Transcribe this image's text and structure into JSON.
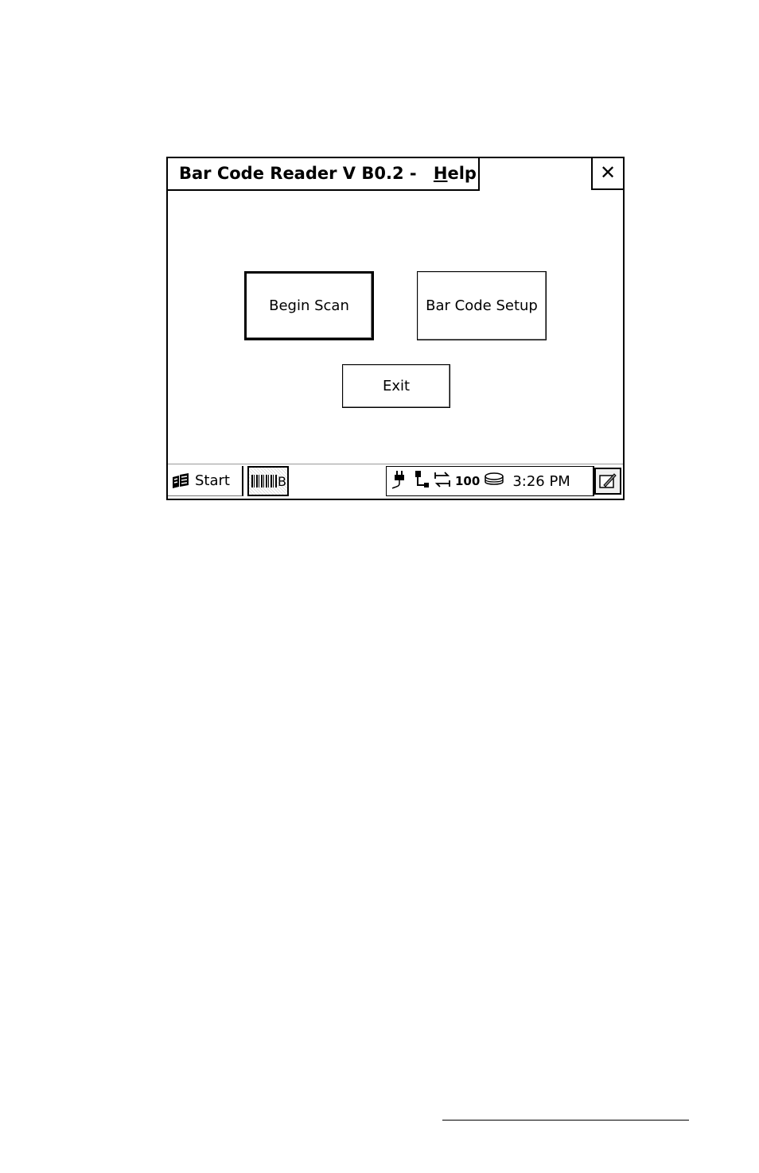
{
  "window": {
    "title": "Bar Code Reader V B0.2 -",
    "help_label": "Help",
    "help_underlined": "H",
    "help_rest": "elp",
    "close_label": "✕"
  },
  "buttons": {
    "begin_scan": "Begin Scan",
    "bar_code_setup": "Bar Code Setup",
    "exit": "Exit"
  },
  "taskbar": {
    "start_label": "Start",
    "task_label": "B",
    "clock": "3:26 PM",
    "tray_icons": [
      "power-plug-icon",
      "network-icon",
      "sync-icon",
      "volume-100-icon",
      "disk-icon"
    ],
    "tray_level_text": "100"
  }
}
